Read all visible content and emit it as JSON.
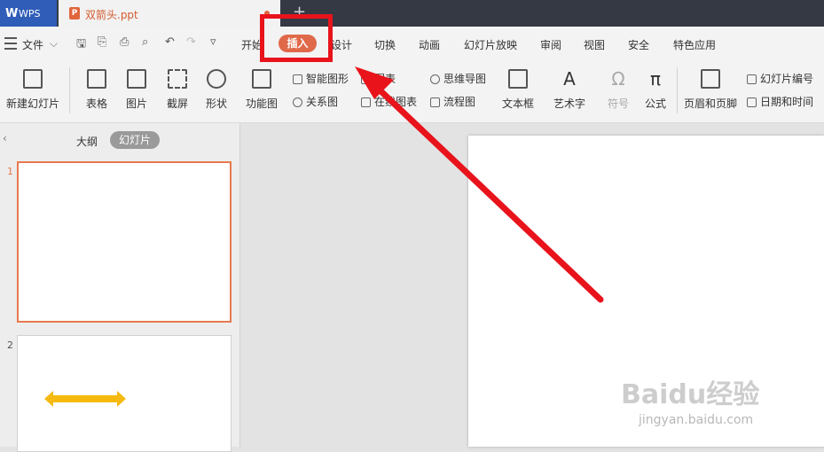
{
  "tabs": {
    "app_label": "WPS",
    "doc_label": "双箭头.ppt",
    "doc_icon": "P",
    "new_tab": "+"
  },
  "menu": {
    "file": "文件",
    "items": [
      "开始",
      "插入",
      "设计",
      "切换",
      "动画",
      "幻灯片放映",
      "审阅",
      "视图",
      "安全",
      "特色应用"
    ],
    "active": "插入"
  },
  "ribbon": {
    "new_slide": "新建幻灯片",
    "table": "表格",
    "picture": "图片",
    "screenshot": "截屏",
    "shape": "形状",
    "function_chart": "功能图",
    "smartart": "智能图形",
    "chart": "图表",
    "relation": "关系图",
    "online_chart": "在线图表",
    "mindmap": "思维导图",
    "flowchart": "流程图",
    "textbox": "文本框",
    "wordart": "艺术字",
    "symbol": "符号",
    "formula": "公式",
    "header_footer": "页眉和页脚",
    "slide_number": "幻灯片编号",
    "date_time": "日期和时间"
  },
  "panel": {
    "outline_tab": "大纲",
    "slides_tab": "幻灯片",
    "slide_numbers": [
      "1",
      "2"
    ]
  },
  "colors": {
    "accent": "#e0694a",
    "annotation_red": "#e8131b",
    "double_arrow": "#f6b90f"
  },
  "watermark": {
    "main": "Baidu经验",
    "sub": "jingyan.baidu.com"
  }
}
